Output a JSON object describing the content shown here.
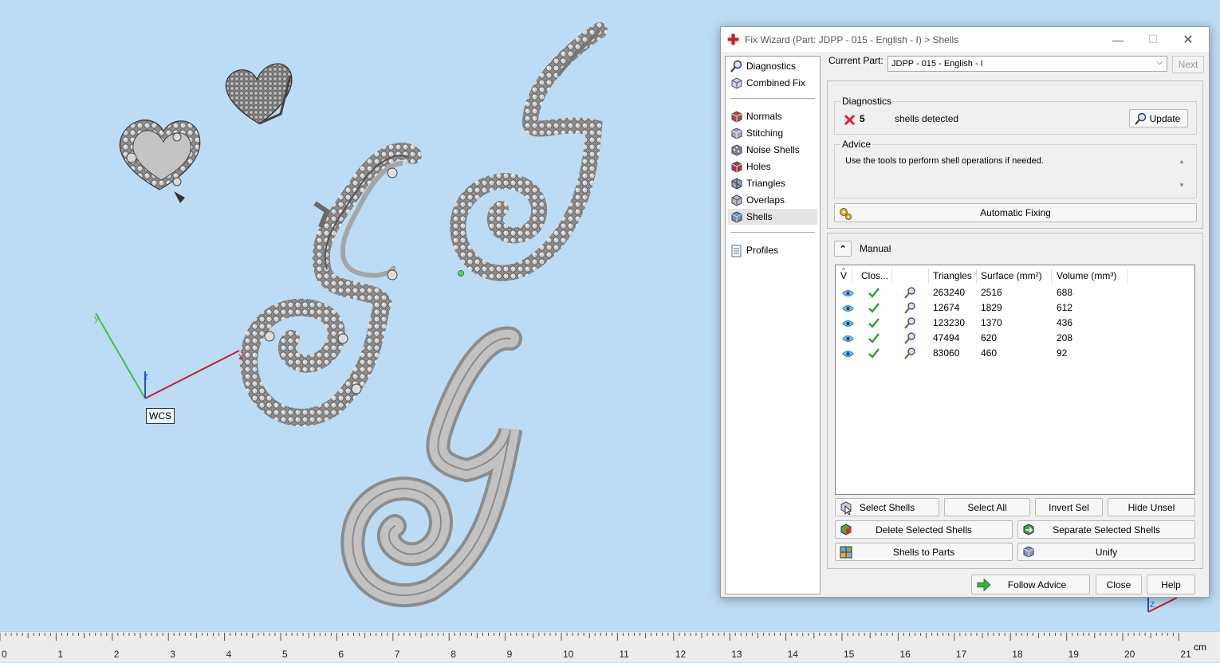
{
  "viewport": {
    "wcs_label": "WCS",
    "axis_x": "x",
    "axis_y": "y",
    "axis_z": "z",
    "ruler_unit": "cm",
    "ruler_numbers": [
      "0",
      "1",
      "2",
      "3",
      "4",
      "5",
      "6",
      "7",
      "8",
      "9",
      "10",
      "11",
      "12",
      "13",
      "14",
      "15",
      "16",
      "17",
      "18",
      "19",
      "20",
      "21"
    ]
  },
  "dialog": {
    "title": "Fix Wizard (Part: JDPP - 015 - English - I) > Shells",
    "nav": {
      "items": [
        {
          "label": "Diagnostics",
          "icon": "magnifier-icon"
        },
        {
          "label": "Combined Fix",
          "icon": "cube-icon"
        },
        {
          "label": "Normals",
          "icon": "normals-icon"
        },
        {
          "label": "Stitching",
          "icon": "stitching-icon"
        },
        {
          "label": "Noise Shells",
          "icon": "noise-shells-icon"
        },
        {
          "label": "Holes",
          "icon": "holes-icon"
        },
        {
          "label": "Triangles",
          "icon": "triangles-icon"
        },
        {
          "label": "Overlaps",
          "icon": "overlaps-icon"
        },
        {
          "label": "Shells",
          "icon": "shells-icon"
        },
        {
          "label": "Profiles",
          "icon": "document-icon"
        }
      ],
      "active": "Shells"
    },
    "current_part_label": "Current Part:",
    "current_part_value": "JDPP - 015 - English - I",
    "next_label": "Next",
    "diagnostics": {
      "title": "Diagnostics",
      "count": "5",
      "text": "shells detected",
      "update_label": "Update"
    },
    "advice": {
      "title": "Advice",
      "text": "Use the tools to perform shell operations if needed."
    },
    "automatic_fixing_label": "Automatic Fixing",
    "manual_label": "Manual",
    "table": {
      "headers": {
        "v": "V",
        "closed": "Clos...",
        "triangles": "Triangles",
        "surface": "Surface (mm²)",
        "volume": "Volume (mm³)"
      },
      "rows": [
        {
          "triangles": "263240",
          "surface": "2516",
          "volume": "688"
        },
        {
          "triangles": "12674",
          "surface": "1829",
          "volume": "612"
        },
        {
          "triangles": "123230",
          "surface": "1370",
          "volume": "436"
        },
        {
          "triangles": "47494",
          "surface": "620",
          "volume": "208"
        },
        {
          "triangles": "83060",
          "surface": "460",
          "volume": "92"
        }
      ]
    },
    "buttons": {
      "select_shells": "Select Shells",
      "select_all": "Select All",
      "invert_sel": "Invert Sel",
      "hide_unsel": "Hide Unsel",
      "delete_selected": "Delete Selected Shells",
      "separate_selected": "Separate Selected Shells",
      "shells_to_parts": "Shells to Parts",
      "unify": "Unify",
      "follow_advice": "Follow Advice",
      "close": "Close",
      "help": "Help"
    }
  }
}
